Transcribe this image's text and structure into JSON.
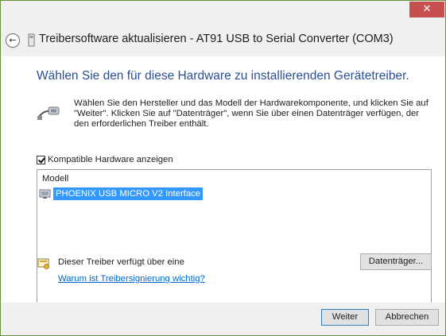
{
  "window": {
    "close_glyph": "✕",
    "title": "Treibersoftware aktualisieren - AT91 USB to Serial Converter (COM3)"
  },
  "page": {
    "heading": "Wählen Sie den für diese Hardware zu installierenden Gerätetreiber.",
    "description": "Wählen Sie den Hersteller und das Modell der Hardwarekomponente, und klicken Sie auf \"Weiter\". Klicken Sie auf \"Datenträger\", wenn Sie über einen Datenträger verfügen, der den erforderlichen Treiber enthält.",
    "checkbox_label": "Kompatible Hardware anzeigen",
    "checkbox_checked": true,
    "list": {
      "column_header": "Modell",
      "items": [
        {
          "label": "PHOENIX USB MICRO V2 Interface",
          "selected": true
        }
      ]
    },
    "signature_text": "Dieser Treiber verfügt über eine",
    "signature_link": "Warum ist Treibersignierung wichtig?",
    "disk_button": "Datenträger..."
  },
  "footer": {
    "next_button": "Weiter",
    "cancel_button": "Abbrechen"
  },
  "colors": {
    "heading": "#2a4f94",
    "selection": "#3399ff",
    "link": "#0066cc",
    "close_button": "#c7504f"
  },
  "icons": {
    "back": "back-arrow-icon",
    "hardware": "serial-cable-icon",
    "device": "device-icon",
    "signature": "unsigned-driver-icon"
  }
}
